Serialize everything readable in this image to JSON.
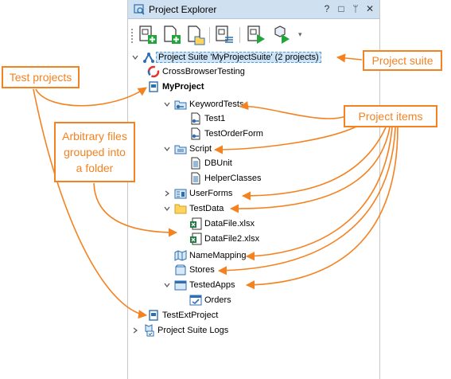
{
  "panel": {
    "title": "Project Explorer",
    "controls": {
      "help": "?",
      "maximize": "□",
      "pin": "ᛘ",
      "close": "✕"
    }
  },
  "toolbar": {
    "buttons": [
      "add-new-project-icon",
      "add-new-item-icon",
      "add-existing-item-icon",
      "project-properties-icon",
      "run-project-icon",
      "run-options-icon"
    ],
    "dropdown": "▾"
  },
  "tree": {
    "suite": "Project Suite 'MyProjectSuite' (2 projects)",
    "cross": "CrossBrowserTesting",
    "myproject": "MyProject",
    "keywordtests": "KeywordTests",
    "test1": "Test1",
    "testorderform": "TestOrderForm",
    "script": "Script",
    "dbunit": "DBUnit",
    "helperclasses": "HelperClasses",
    "userforms": "UserForms",
    "testdata": "TestData",
    "datafile": "DataFile.xlsx",
    "datafile2": "DataFile2.xlsx",
    "namemapping": "NameMapping",
    "stores": "Stores",
    "testedapps": "TestedApps",
    "orders": "Orders",
    "testextproject": "TestExtProject",
    "suitelogs": "Project Suite Logs"
  },
  "callouts": {
    "test_projects": "Test projects",
    "arbitrary_files": "Arbitrary files grouped into a folder",
    "project_items": "Project items",
    "project_suite": "Project suite"
  },
  "colors": {
    "accent": "#f58220",
    "selection": "#cce4f7",
    "titlebar": "#cfe0f0"
  }
}
